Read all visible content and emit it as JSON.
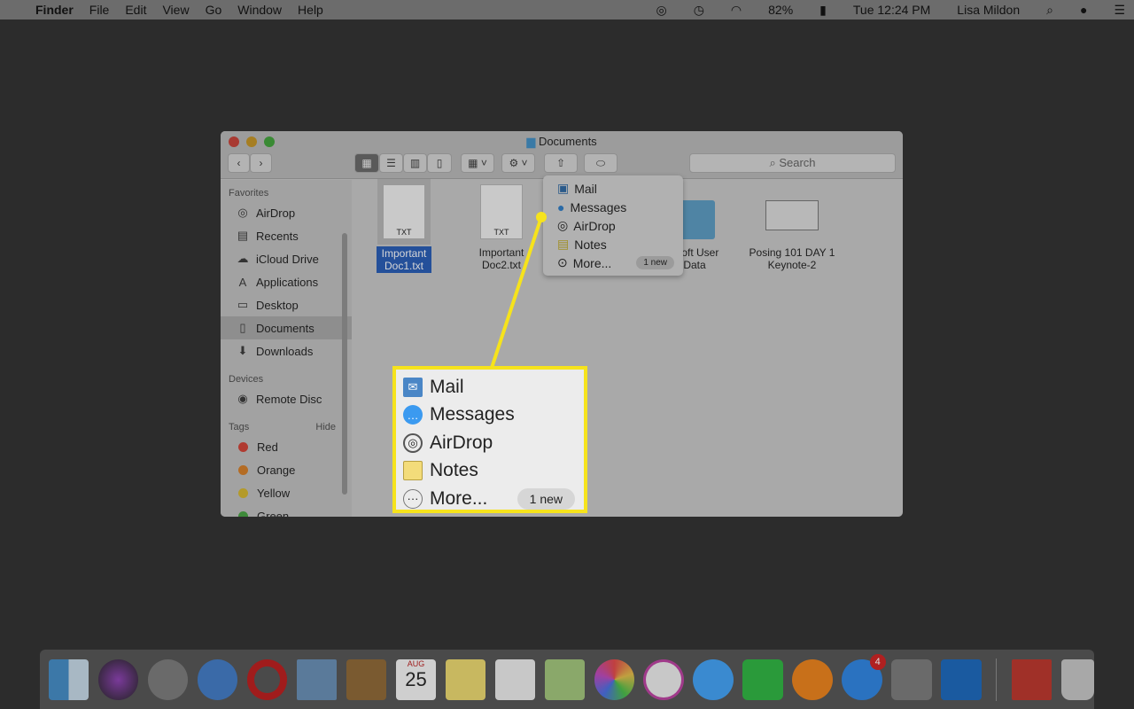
{
  "menubar": {
    "app": "Finder",
    "items": [
      "File",
      "Edit",
      "View",
      "Go",
      "Window",
      "Help"
    ],
    "battery": "82%",
    "clock": "Tue 12:24 PM",
    "user": "Lisa Mildon"
  },
  "window": {
    "title": "Documents",
    "search_placeholder": "Search"
  },
  "sidebar": {
    "favorites_header": "Favorites",
    "favorites": [
      {
        "label": "AirDrop",
        "icon": "airdrop-icon"
      },
      {
        "label": "Recents",
        "icon": "recents-icon"
      },
      {
        "label": "iCloud Drive",
        "icon": "cloud-icon"
      },
      {
        "label": "Applications",
        "icon": "applications-icon"
      },
      {
        "label": "Desktop",
        "icon": "desktop-icon"
      },
      {
        "label": "Documents",
        "icon": "documents-icon",
        "selected": true
      },
      {
        "label": "Downloads",
        "icon": "downloads-icon"
      }
    ],
    "devices_header": "Devices",
    "devices": [
      {
        "label": "Remote Disc"
      }
    ],
    "tags_header": "Tags",
    "tags_hide": "Hide",
    "tags": [
      {
        "label": "Red",
        "color": "#b03a30"
      },
      {
        "label": "Orange",
        "color": "#b46c24"
      },
      {
        "label": "Yellow",
        "color": "#b49a2a"
      },
      {
        "label": "Green",
        "color": "#3e8a3a"
      }
    ]
  },
  "files": [
    {
      "name": "Important Doc1.txt",
      "kind": "TXT",
      "selected": true
    },
    {
      "name": "Important Doc2.txt",
      "kind": "TXT"
    },
    {
      "name": "osoft User Data"
    },
    {
      "name": "Posing 101 DAY 1 Keynote-2"
    }
  ],
  "share_menu": {
    "items": [
      {
        "label": "Mail"
      },
      {
        "label": "Messages"
      },
      {
        "label": "AirDrop"
      },
      {
        "label": "Notes"
      },
      {
        "label": "More..."
      }
    ],
    "badge": "1 new"
  },
  "dock": {
    "apps": [
      "Finder",
      "Siri",
      "Launchpad",
      "Safari",
      "Opera",
      "Mail",
      "Contacts",
      "Calendar",
      "Notes",
      "Reminders",
      "Maps",
      "Photos",
      "iTunes",
      "Messages",
      "FaceTime",
      "iBooks",
      "App Store",
      "System Preferences",
      "Outlook",
      "Downloads",
      "Trash"
    ],
    "calendar_month": "AUG",
    "calendar_day": "25",
    "appstore_badge": "4"
  },
  "colors": {
    "callout_border": "#f6e31c"
  }
}
